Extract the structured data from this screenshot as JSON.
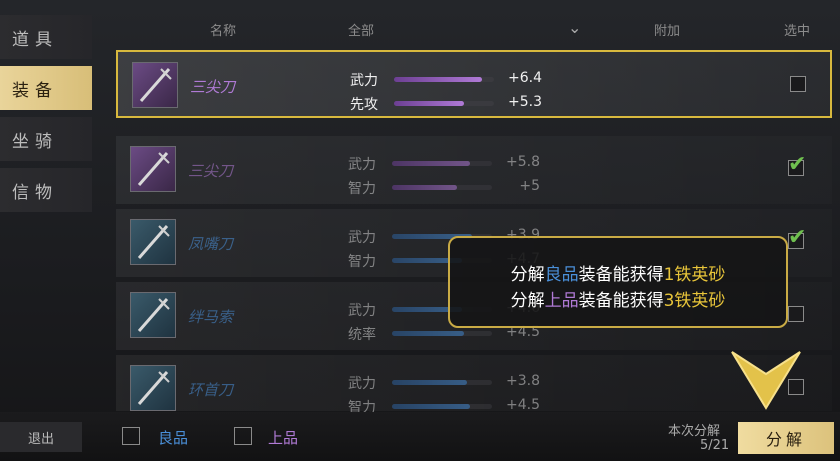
{
  "sidebar": {
    "items": [
      {
        "label": "道具"
      },
      {
        "label": "装备"
      },
      {
        "label": "坐骑"
      },
      {
        "label": "信物"
      }
    ]
  },
  "header": {
    "name_col": "名称",
    "filter": "全部",
    "extra_col": "附加",
    "select_col": "选中"
  },
  "items": [
    {
      "name": "三尖刀",
      "rarity": "purple",
      "selected": true,
      "checked": false,
      "stats": [
        {
          "label": "武力",
          "value": "+6.4",
          "fill": 0.88
        },
        {
          "label": "先攻",
          "value": "+5.3",
          "fill": 0.7
        }
      ]
    },
    {
      "name": "三尖刀",
      "rarity": "purple",
      "selected": false,
      "checked": true,
      "stats": [
        {
          "label": "武力",
          "value": "+5.8",
          "fill": 0.78
        },
        {
          "label": "智力",
          "value": "+5",
          "fill": 0.65
        }
      ]
    },
    {
      "name": "凤嘴刀",
      "rarity": "blue",
      "selected": false,
      "checked": true,
      "stats": [
        {
          "label": "武力",
          "value": "+3.9",
          "fill": 0.8
        },
        {
          "label": "智力",
          "value": "+4.7",
          "fill": 0.7
        }
      ]
    },
    {
      "name": "绊马索",
      "rarity": "blue",
      "selected": false,
      "checked": false,
      "stats": [
        {
          "label": "武力",
          "value": "+4.6",
          "fill": 0.7
        },
        {
          "label": "统率",
          "value": "+4.5",
          "fill": 0.72
        }
      ]
    },
    {
      "name": "环首刀",
      "rarity": "blue",
      "selected": false,
      "checked": false,
      "stats": [
        {
          "label": "武力",
          "value": "+3.8",
          "fill": 0.75
        },
        {
          "label": "智力",
          "value": "+4.5",
          "fill": 0.78
        }
      ]
    }
  ],
  "tooltip": {
    "line1": {
      "prefix": "分解",
      "quality": "良品",
      "middle": "装备能获得",
      "amount": "1",
      "reward": "铁英砂"
    },
    "line2": {
      "prefix": "分解",
      "quality": "上品",
      "middle": "装备能获得",
      "amount": "3",
      "reward": "铁英砂"
    }
  },
  "bottom": {
    "exit": "退出",
    "filter1": "良品",
    "filter2": "上品",
    "count_label": "本次分解",
    "count": "5/21",
    "decompose": "分解"
  },
  "colors": {
    "gold": "#d8b93e",
    "purple": "#b07ad6",
    "blue": "#4a8fd8",
    "check": "#6fbf4f"
  }
}
